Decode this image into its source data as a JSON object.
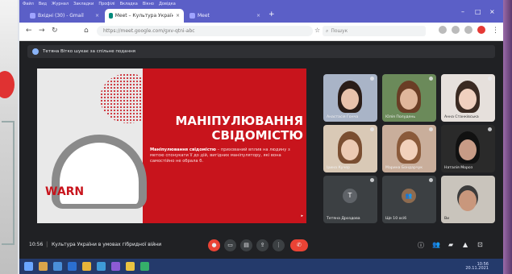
{
  "browser": {
    "menu": [
      "Файл",
      "Вид",
      "Журнал",
      "Закладки",
      "Профілі",
      "Вкладка",
      "Вікно",
      "Довідка"
    ],
    "tabs": [
      {
        "title": "Вхідні (30) - Gmail"
      },
      {
        "title": "Meet – Культура України у умовах"
      },
      {
        "title": "Meet"
      }
    ],
    "url": "https://meet.google.com/gxv-qtni-abc",
    "search_placeholder": "Пошук"
  },
  "meet": {
    "notification": "Тетяна Вітко шукає за спільне подання",
    "slide": {
      "title_line1": "МАНІПУЛЮВАННЯ",
      "title_line2": "СВІДОМІСТЮ",
      "body_bold": "Маніпулювання свідомістю",
      "body": " – прихований вплив на людину з метою спонукати її до дій, вигідних маніпулятору, які вона самостійно не обрала б.",
      "logo_text": "WARN",
      "page_marker": "▸"
    },
    "participants": [
      {
        "name": "Анастасія Гонча"
      },
      {
        "name": "Юлія Полудень"
      },
      {
        "name": "Анна Станківська"
      },
      {
        "name": "Ірина Кучер"
      },
      {
        "name": "Марина Бондарчук"
      },
      {
        "name": "Наталія Мороз"
      },
      {
        "name": "Тетяна Дроздова",
        "avatar": "Т"
      },
      {
        "name": "Ще 10 осіб",
        "avatar": "👥"
      },
      {
        "name": "Ви"
      }
    ],
    "time": "10:56",
    "meeting_title": "Культура України в умовах гібридної війни"
  },
  "taskbar": {
    "time": "10:56",
    "date": "20.11.2021"
  },
  "colors": {
    "browser_accent": "#5b5fc7",
    "slide_red": "#c8141c",
    "end_call": "#ea4335"
  }
}
